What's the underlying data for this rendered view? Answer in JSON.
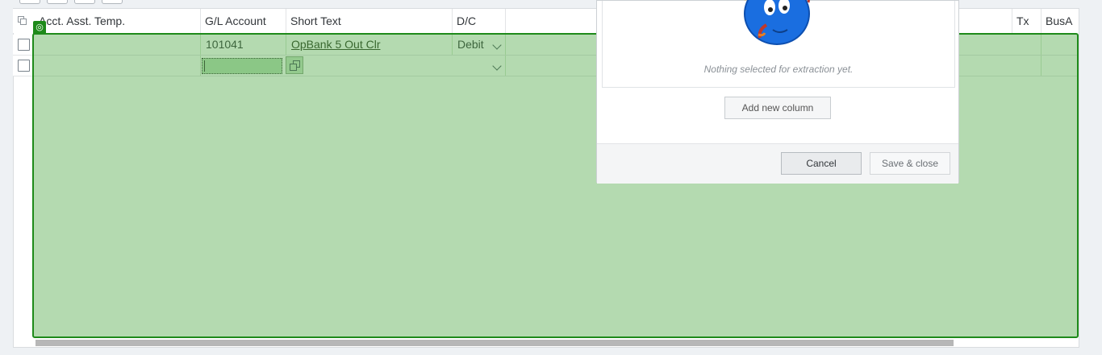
{
  "table": {
    "columns": [
      {
        "id": "acct_asst_temp",
        "label": "Acct. Asst. Temp."
      },
      {
        "id": "gl_account",
        "label": "G/L Account"
      },
      {
        "id": "short_text",
        "label": "Short Text"
      },
      {
        "id": "dc",
        "label": "D/C"
      },
      {
        "id": "tx",
        "label": "Tx"
      },
      {
        "id": "busa",
        "label": "BusA"
      }
    ],
    "rows": [
      {
        "acct_asst_temp": "",
        "gl_account": "101041",
        "short_text": "OpBank 5 Out Clr",
        "dc": "Debit",
        "tx": "",
        "busa": ""
      },
      {
        "acct_asst_temp": "",
        "gl_account": "",
        "short_text": "",
        "dc": "",
        "tx": "",
        "busa": ""
      }
    ]
  },
  "dialog": {
    "empty_message": "Nothing selected for extraction yet.",
    "add_column_label": "Add new column",
    "cancel_label": "Cancel",
    "save_close_label": "Save & close"
  },
  "icons": {
    "select_all": "select-all-icon",
    "dropdown": "chevron-down-icon",
    "value_help": "value-help-icon",
    "selection_target": "target-icon",
    "mascot": "mascot-illustration"
  },
  "colors": {
    "selection_overlay": "#4ca642",
    "selection_border": "#1e8a1a",
    "mascot_blue": "#1a6ee0"
  }
}
